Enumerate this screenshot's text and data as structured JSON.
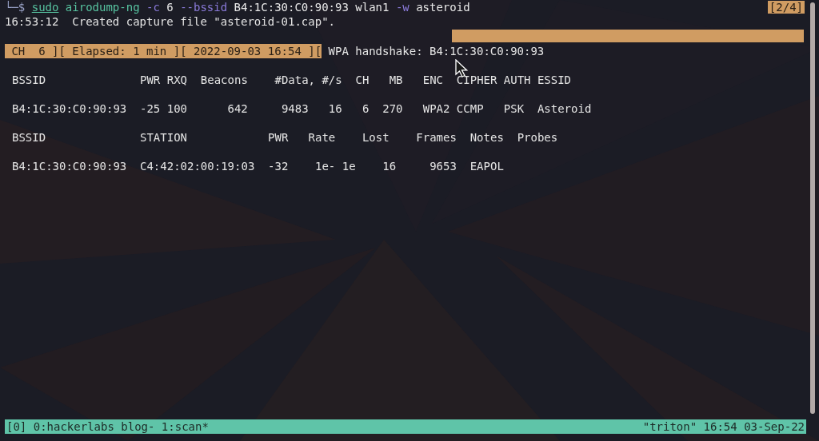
{
  "prompt": {
    "symbol": "└─$",
    "words": [
      {
        "text": "sudo",
        "kind": "command",
        "underlined": true
      },
      {
        "text": "airodump-ng",
        "kind": "command",
        "underlined": false
      },
      {
        "text": "-c",
        "kind": "option",
        "underlined": false
      },
      {
        "text": "6",
        "kind": "arg",
        "underlined": false
      },
      {
        "text": "--bssid",
        "kind": "option",
        "underlined": false
      },
      {
        "text": "B4:1C:30:C0:90:93",
        "kind": "arg",
        "underlined": false
      },
      {
        "text": "wlan1",
        "kind": "arg",
        "underlined": false
      },
      {
        "text": "-w",
        "kind": "option",
        "underlined": false
      },
      {
        "text": "asteroid",
        "kind": "arg",
        "underlined": false
      }
    ]
  },
  "output_line": "16:53:12  Created capture file \"asteroid-01.cap\".",
  "pane_index": "[2/4]",
  "status": {
    "highlighted": " CH  6 ][ Elapsed: 1 min ][ 2022-09-03 16:54 ][",
    "message": "WPA handshake: B4:1C:30:C0:90:93"
  },
  "ap_table": {
    "header": [
      "BSSID",
      "PWR",
      "RXQ",
      "Beacons",
      "#Data,",
      "#/s",
      "CH",
      "MB",
      "ENC",
      "CIPHER",
      "AUTH",
      "ESSID"
    ],
    "rows": [
      [
        "B4:1C:30:C0:90:93",
        "-25",
        "100",
        "642",
        "9483",
        "16",
        "6",
        "270",
        "WPA2",
        "CCMP",
        "PSK",
        "Asteroid"
      ]
    ]
  },
  "station_table": {
    "header": [
      "BSSID",
      "STATION",
      "PWR",
      "Rate",
      "Lost",
      "Frames",
      "Notes",
      "Probes"
    ],
    "rows": [
      [
        "B4:1C:30:C0:90:93",
        "C4:42:02:00:19:03",
        "-32",
        "1e- 1e",
        "16",
        "9653",
        "EAPOL"
      ]
    ]
  },
  "tmux_bar": {
    "left": "[0] 0:hackerlabs blog- 1:scan*",
    "right": "\"triton\" 16:54 03-Sep-22"
  }
}
